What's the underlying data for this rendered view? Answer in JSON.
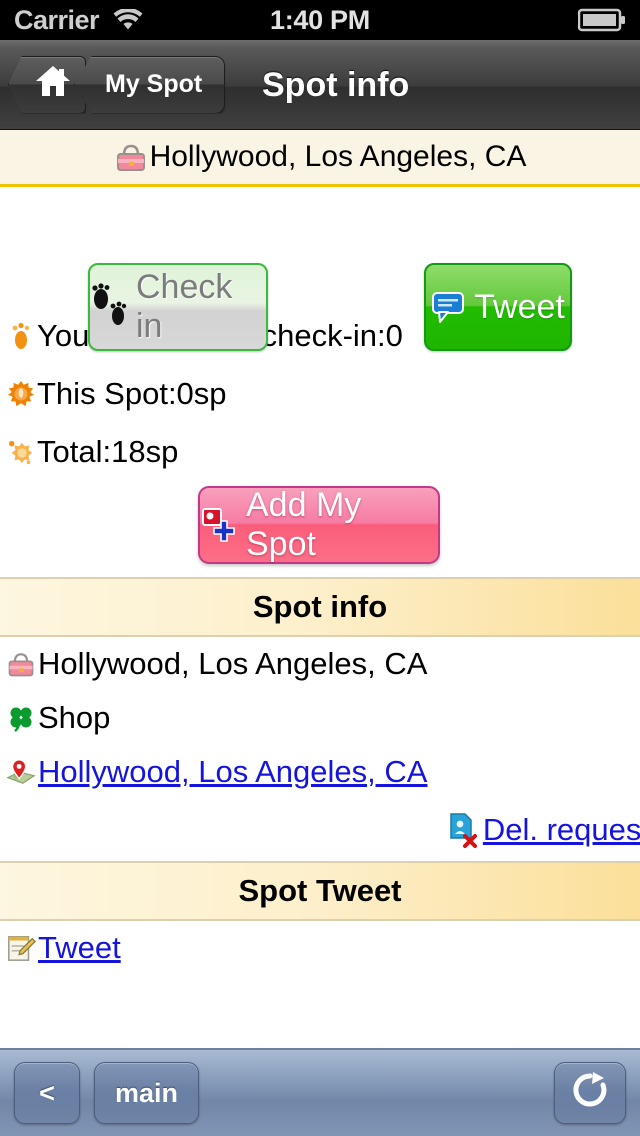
{
  "status_bar": {
    "carrier": "Carrier",
    "wifi_icon": "wifi-icon",
    "time": "1:40 PM",
    "battery_icon": "battery-full-icon"
  },
  "nav_bar": {
    "home_icon": "home-icon",
    "back_label": "My Spot",
    "title": "Spot info"
  },
  "location_banner": {
    "icon": "handbag-icon",
    "text": "Hollywood, Los Angeles, CA"
  },
  "actions": {
    "checkin": {
      "label": "Check in",
      "icon": "footprints-icon",
      "disabled": true
    },
    "tweet": {
      "label": "Tweet",
      "icon": "speech-balloon-icon",
      "disabled": false
    }
  },
  "stats": [
    {
      "icon": "footprint-orange-icon",
      "text": "Your Number of check-in:0"
    },
    {
      "icon": "sun-orange-icon",
      "text": "This Spot:0sp"
    },
    {
      "icon": "sparkle-orange-icon",
      "text": "Total:18sp"
    }
  ],
  "add_my_spot": {
    "label": "Add My Spot",
    "icon": "add-flag-icon"
  },
  "spot_info": {
    "heading": "Spot info",
    "address": {
      "icon": "handbag-icon",
      "text": "Hollywood, Los Angeles, CA"
    },
    "category": {
      "icon": "clover-icon",
      "text": "Shop"
    },
    "map_link": {
      "icon": "map-pin-icon",
      "text": "Hollywood, Los Angeles, CA"
    },
    "delete_request": {
      "icon": "delete-page-icon",
      "text": "Del. request"
    }
  },
  "spot_tweet": {
    "heading": "Spot Tweet",
    "tweet_link": {
      "icon": "memo-icon",
      "text": "Tweet"
    }
  },
  "toolbar": {
    "back_label": "<",
    "main_label": "main",
    "refresh_icon": "refresh-icon"
  },
  "colors": {
    "accent_yellow": "#f2c200",
    "section_header": "#fbdf9a",
    "tweet_green": "#21bc00",
    "addspot_pink": "#fb5d79",
    "link_blue": "#1414dd",
    "toolbar_blue": "#7286a8"
  }
}
